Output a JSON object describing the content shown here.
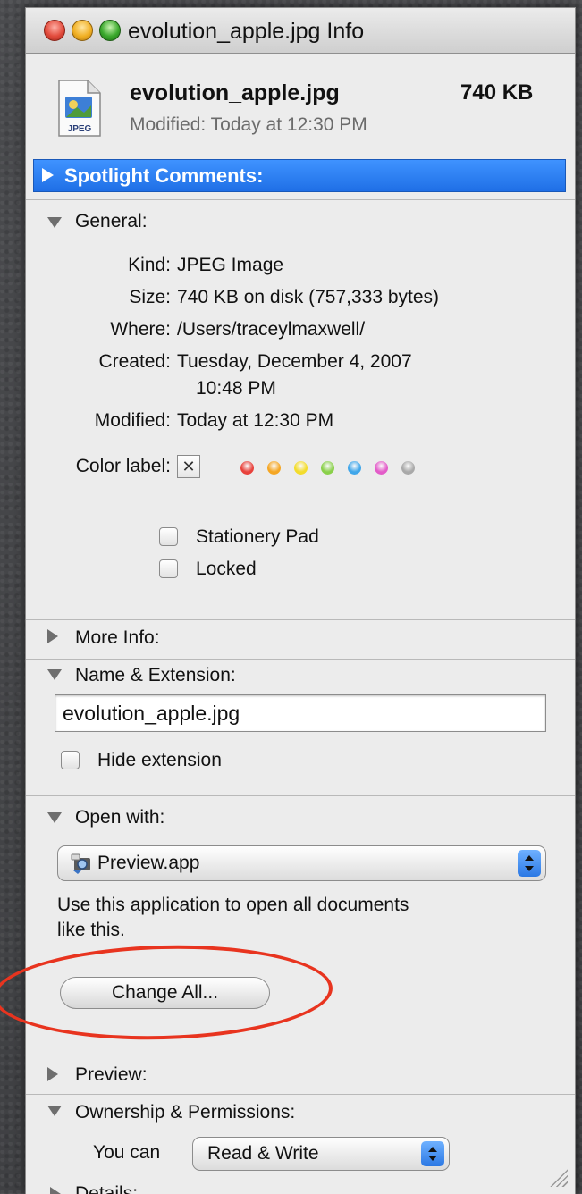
{
  "window": {
    "title": "evolution_apple.jpg Info"
  },
  "file": {
    "name": "evolution_apple.jpg",
    "size": "740 KB",
    "modified": "Modified: Today at 12:30 PM",
    "icon_label": "JPEG"
  },
  "spotlight": {
    "label": "Spotlight Comments:"
  },
  "general": {
    "label": "General:",
    "kind_label": "Kind:",
    "kind_value": "JPEG Image",
    "size_label": "Size:",
    "size_value": "740 KB on disk (757,333 bytes)",
    "where_label": "Where:",
    "where_value": "/Users/traceylmaxwell/",
    "created_label": "Created:",
    "created_value_line1": "Tuesday, December 4, 2007",
    "created_value_line2": "10:48 PM",
    "modified_label": "Modified:",
    "modified_value": "Today at 12:30 PM",
    "color_label": "Color label:",
    "color_none_glyph": "✕",
    "color_dots": [
      "#e8423c",
      "#f5a623",
      "#f3dc2c",
      "#8ad04a",
      "#3fa6ea",
      "#e35cc9",
      "#a9a9a9"
    ],
    "stationery_label": "Stationery Pad",
    "locked_label": "Locked"
  },
  "more_info": {
    "label": "More Info:"
  },
  "name_ext": {
    "label": "Name & Extension:",
    "value": "evolution_apple.jpg",
    "hide_ext_label": "Hide extension"
  },
  "open_with": {
    "label": "Open with:",
    "app": "Preview.app",
    "desc_line1": "Use this application to open all documents",
    "desc_line2": "like this.",
    "change_all": "Change All..."
  },
  "preview": {
    "label": "Preview:"
  },
  "ownership": {
    "label": "Ownership & Permissions:",
    "you_can": "You can",
    "permission": "Read & Write",
    "details": "Details:"
  },
  "colors": {
    "selection_blue": "#2a7bef",
    "annotation_red": "#e8341f"
  }
}
